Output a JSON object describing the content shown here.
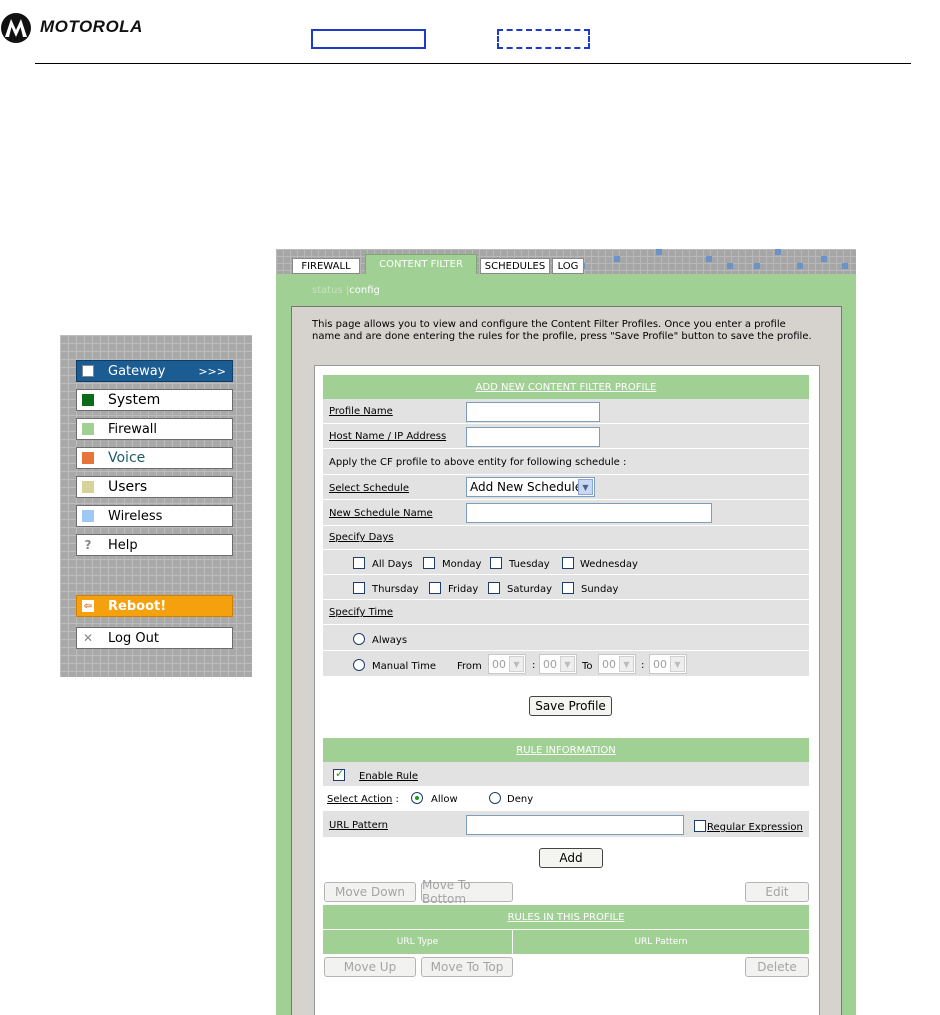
{
  "brand": {
    "name": "MOTOROLA",
    "accent": "#1b5c93"
  },
  "sidebar": {
    "items": [
      {
        "label": "Gateway",
        "swatch": "#ffffff",
        "chevron": ">>>",
        "active": true
      },
      {
        "label": "System",
        "swatch": "#0b6b19"
      },
      {
        "label": "Firewall",
        "swatch": "#a1d095"
      },
      {
        "label": "Voice",
        "swatch": "#e7743a"
      },
      {
        "label": "Users",
        "swatch": "#d6d29a"
      },
      {
        "label": "Wireless",
        "swatch": "#9ec8f5"
      },
      {
        "label": "Help",
        "icon": "?"
      }
    ],
    "reboot": {
      "label": "Reboot!",
      "icon": "⇦"
    },
    "logout": {
      "label": "Log Out",
      "icon": "✕"
    }
  },
  "tabs": [
    {
      "label": "FIREWALL"
    },
    {
      "label": "CONTENT FILTER",
      "active": true
    },
    {
      "label": "SCHEDULES"
    },
    {
      "label": "LOG"
    }
  ],
  "subnav": {
    "status": "status",
    "sep": "|",
    "config": "config"
  },
  "intro": "This page allows you to view and configure the Content Filter Profiles. Once you enter a profile name and are done entering the rules for the profile, press \"Save Profile\" button to save the profile.",
  "profile": {
    "header": "ADD NEW CONTENT FILTER PROFILE",
    "profile_name_label": "Profile Name",
    "profile_name_value": "",
    "host_label": "Host Name / IP Address",
    "host_value": "",
    "apply_text": "Apply the CF profile to above entity for following schedule :",
    "select_schedule_label": "Select Schedule",
    "select_schedule_value": "Add New Schedule",
    "new_schedule_label": "New Schedule Name",
    "new_schedule_value": "",
    "specify_days_label": "Specify Days",
    "days": [
      "All Days",
      "Monday",
      "Tuesday",
      "Wednesday",
      "Thursday",
      "Friday",
      "Saturday",
      "Sunday"
    ],
    "specify_time_label": "Specify Time",
    "always_label": "Always",
    "manual_label": "Manual Time",
    "from_label": "From",
    "to_label": "To",
    "colon": ":",
    "time_values": [
      "00",
      "00",
      "00",
      "00"
    ],
    "save_button": "Save Profile"
  },
  "rule": {
    "header": "RULE INFORMATION",
    "enable_label": "Enable Rule",
    "enable_checked": true,
    "action_label": "Select Action",
    "action_colon": ":",
    "allow_label": "Allow",
    "deny_label": "Deny",
    "url_label": "URL Pattern",
    "url_value": "",
    "regex_label": "Regular Expression",
    "add_button": "Add"
  },
  "rules_list": {
    "move_down": "Move Down",
    "move_bottom": "Move To Bottom",
    "edit": "Edit",
    "header": "RULES IN THIS PROFILE",
    "col_type": "URL Type",
    "col_pattern": "URL Pattern",
    "move_up": "Move Up",
    "move_top": "Move To Top",
    "delete": "Delete"
  }
}
